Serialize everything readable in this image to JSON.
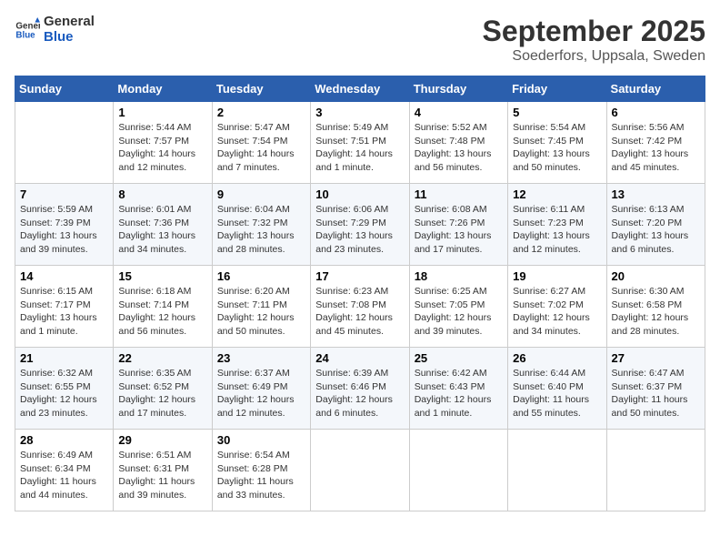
{
  "logo": {
    "text_general": "General",
    "text_blue": "Blue"
  },
  "title": "September 2025",
  "location": "Soederfors, Uppsala, Sweden",
  "days_of_week": [
    "Sunday",
    "Monday",
    "Tuesday",
    "Wednesday",
    "Thursday",
    "Friday",
    "Saturday"
  ],
  "weeks": [
    [
      {
        "day": "",
        "info": ""
      },
      {
        "day": "1",
        "info": "Sunrise: 5:44 AM\nSunset: 7:57 PM\nDaylight: 14 hours\nand 12 minutes."
      },
      {
        "day": "2",
        "info": "Sunrise: 5:47 AM\nSunset: 7:54 PM\nDaylight: 14 hours\nand 7 minutes."
      },
      {
        "day": "3",
        "info": "Sunrise: 5:49 AM\nSunset: 7:51 PM\nDaylight: 14 hours\nand 1 minute."
      },
      {
        "day": "4",
        "info": "Sunrise: 5:52 AM\nSunset: 7:48 PM\nDaylight: 13 hours\nand 56 minutes."
      },
      {
        "day": "5",
        "info": "Sunrise: 5:54 AM\nSunset: 7:45 PM\nDaylight: 13 hours\nand 50 minutes."
      },
      {
        "day": "6",
        "info": "Sunrise: 5:56 AM\nSunset: 7:42 PM\nDaylight: 13 hours\nand 45 minutes."
      }
    ],
    [
      {
        "day": "7",
        "info": "Sunrise: 5:59 AM\nSunset: 7:39 PM\nDaylight: 13 hours\nand 39 minutes."
      },
      {
        "day": "8",
        "info": "Sunrise: 6:01 AM\nSunset: 7:36 PM\nDaylight: 13 hours\nand 34 minutes."
      },
      {
        "day": "9",
        "info": "Sunrise: 6:04 AM\nSunset: 7:32 PM\nDaylight: 13 hours\nand 28 minutes."
      },
      {
        "day": "10",
        "info": "Sunrise: 6:06 AM\nSunset: 7:29 PM\nDaylight: 13 hours\nand 23 minutes."
      },
      {
        "day": "11",
        "info": "Sunrise: 6:08 AM\nSunset: 7:26 PM\nDaylight: 13 hours\nand 17 minutes."
      },
      {
        "day": "12",
        "info": "Sunrise: 6:11 AM\nSunset: 7:23 PM\nDaylight: 13 hours\nand 12 minutes."
      },
      {
        "day": "13",
        "info": "Sunrise: 6:13 AM\nSunset: 7:20 PM\nDaylight: 13 hours\nand 6 minutes."
      }
    ],
    [
      {
        "day": "14",
        "info": "Sunrise: 6:15 AM\nSunset: 7:17 PM\nDaylight: 13 hours\nand 1 minute."
      },
      {
        "day": "15",
        "info": "Sunrise: 6:18 AM\nSunset: 7:14 PM\nDaylight: 12 hours\nand 56 minutes."
      },
      {
        "day": "16",
        "info": "Sunrise: 6:20 AM\nSunset: 7:11 PM\nDaylight: 12 hours\nand 50 minutes."
      },
      {
        "day": "17",
        "info": "Sunrise: 6:23 AM\nSunset: 7:08 PM\nDaylight: 12 hours\nand 45 minutes."
      },
      {
        "day": "18",
        "info": "Sunrise: 6:25 AM\nSunset: 7:05 PM\nDaylight: 12 hours\nand 39 minutes."
      },
      {
        "day": "19",
        "info": "Sunrise: 6:27 AM\nSunset: 7:02 PM\nDaylight: 12 hours\nand 34 minutes."
      },
      {
        "day": "20",
        "info": "Sunrise: 6:30 AM\nSunset: 6:58 PM\nDaylight: 12 hours\nand 28 minutes."
      }
    ],
    [
      {
        "day": "21",
        "info": "Sunrise: 6:32 AM\nSunset: 6:55 PM\nDaylight: 12 hours\nand 23 minutes."
      },
      {
        "day": "22",
        "info": "Sunrise: 6:35 AM\nSunset: 6:52 PM\nDaylight: 12 hours\nand 17 minutes."
      },
      {
        "day": "23",
        "info": "Sunrise: 6:37 AM\nSunset: 6:49 PM\nDaylight: 12 hours\nand 12 minutes."
      },
      {
        "day": "24",
        "info": "Sunrise: 6:39 AM\nSunset: 6:46 PM\nDaylight: 12 hours\nand 6 minutes."
      },
      {
        "day": "25",
        "info": "Sunrise: 6:42 AM\nSunset: 6:43 PM\nDaylight: 12 hours\nand 1 minute."
      },
      {
        "day": "26",
        "info": "Sunrise: 6:44 AM\nSunset: 6:40 PM\nDaylight: 11 hours\nand 55 minutes."
      },
      {
        "day": "27",
        "info": "Sunrise: 6:47 AM\nSunset: 6:37 PM\nDaylight: 11 hours\nand 50 minutes."
      }
    ],
    [
      {
        "day": "28",
        "info": "Sunrise: 6:49 AM\nSunset: 6:34 PM\nDaylight: 11 hours\nand 44 minutes."
      },
      {
        "day": "29",
        "info": "Sunrise: 6:51 AM\nSunset: 6:31 PM\nDaylight: 11 hours\nand 39 minutes."
      },
      {
        "day": "30",
        "info": "Sunrise: 6:54 AM\nSunset: 6:28 PM\nDaylight: 11 hours\nand 33 minutes."
      },
      {
        "day": "",
        "info": ""
      },
      {
        "day": "",
        "info": ""
      },
      {
        "day": "",
        "info": ""
      },
      {
        "day": "",
        "info": ""
      }
    ]
  ]
}
